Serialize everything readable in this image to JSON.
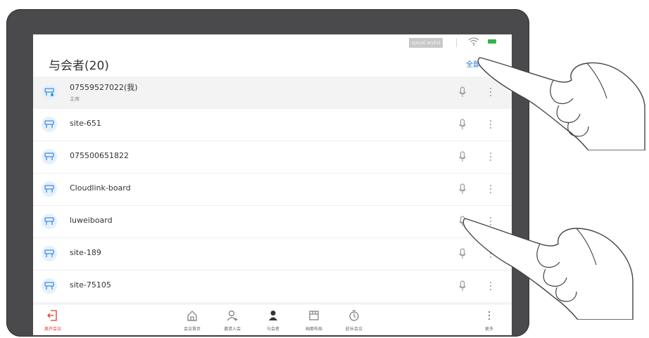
{
  "status": {
    "network_label": "qxuai wyhd"
  },
  "header": {
    "title": "与会者(20)",
    "mute_all": "全部静音"
  },
  "participants": [
    {
      "name": "07559527022(我)",
      "role": "主席"
    },
    {
      "name": "site-651"
    },
    {
      "name": "075500651822"
    },
    {
      "name": "Cloudlink-board"
    },
    {
      "name": "luweiboard"
    },
    {
      "name": "site-189"
    },
    {
      "name": "site-75105"
    }
  ],
  "toolbar": {
    "leave": "离开会议",
    "home": "会议首页",
    "invite": "邀请入会",
    "participants": "与会者",
    "layout": "画面布局",
    "extend": "延长会议",
    "more": "更多"
  },
  "colors": {
    "accent": "#1a73e8",
    "leave": "#e03b2f",
    "battery": "#2fb54a"
  }
}
